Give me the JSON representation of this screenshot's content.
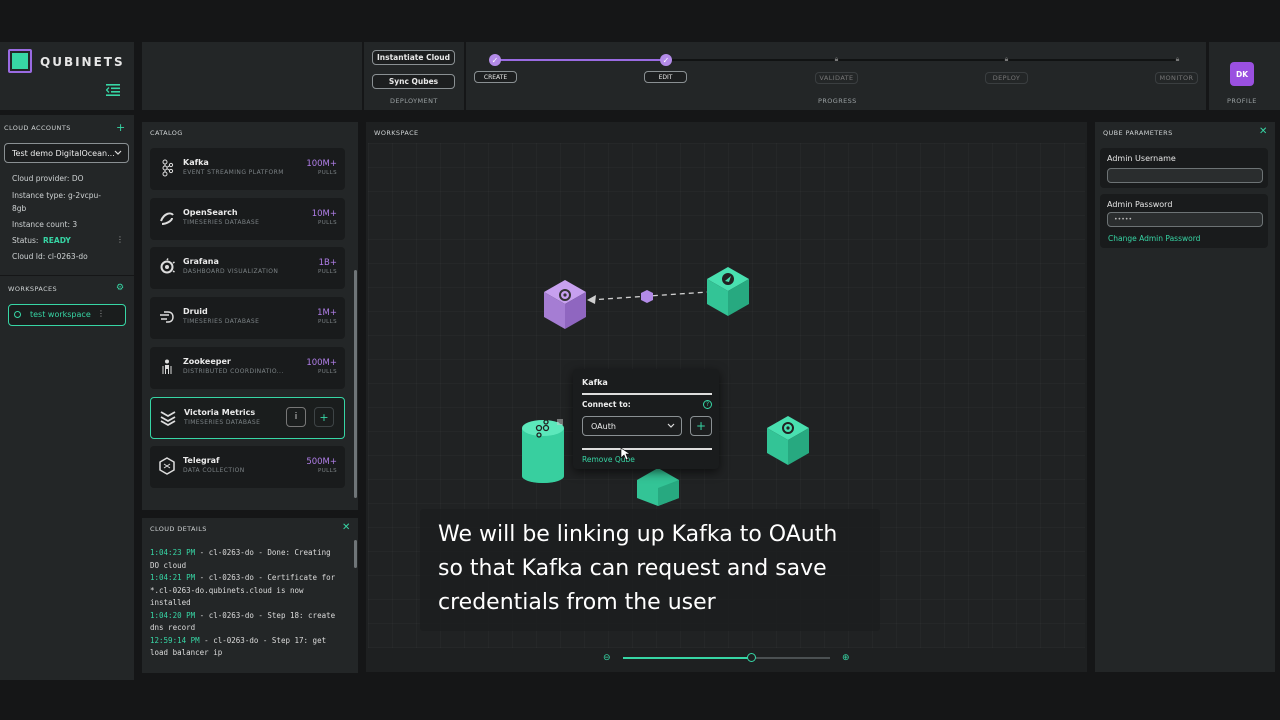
{
  "brand": {
    "name": "QUBINETS"
  },
  "deployment": {
    "instantiate_label": "Instantiate Cloud",
    "sync_label": "Sync Qubes",
    "section_label": "DEPLOYMENT"
  },
  "progress": {
    "section_label": "PROGRESS",
    "steps": [
      {
        "label": "CREATE",
        "state": "done"
      },
      {
        "label": "EDIT",
        "state": "done"
      },
      {
        "label": "VALIDATE",
        "state": "locked"
      },
      {
        "label": "DEPLOY",
        "state": "locked"
      },
      {
        "label": "MONITOR",
        "state": "locked"
      }
    ]
  },
  "profile": {
    "initials": "DK",
    "label": "PROFILE"
  },
  "cloud_accounts": {
    "title": "CLOUD ACCOUNTS",
    "selected": "Test demo DigitalOcean...",
    "provider_line": "Cloud provider: DO",
    "instance_type_line1": "Instance type: g-2vcpu-",
    "instance_type_line2": "8gb",
    "instance_count_line": "Instance count: 3",
    "status_label": "Status:",
    "status_value": "READY",
    "cloud_id_line": "Cloud Id: cl-0263-do"
  },
  "workspaces": {
    "title": "WORKSPACES",
    "items": [
      {
        "label": "test workspace"
      }
    ]
  },
  "catalog": {
    "title": "CATALOG",
    "items": [
      {
        "name": "Kafka",
        "sub": "EVENT STREAMING PLATFORM",
        "pulls": "100M+"
      },
      {
        "name": "OpenSearch",
        "sub": "TIMESERIES DATABASE",
        "pulls": "10M+"
      },
      {
        "name": "Grafana",
        "sub": "DASHBOARD VISUALIZATION",
        "pulls": "1B+"
      },
      {
        "name": "Druid",
        "sub": "TIMESERIES DATABASE",
        "pulls": "1M+"
      },
      {
        "name": "Zookeeper",
        "sub": "DISTRIBUTED COORDINATIO...",
        "pulls": "100M+"
      },
      {
        "name": "Victoria Metrics",
        "sub": "TIMESERIES DATABASE",
        "pulls": ""
      },
      {
        "name": "Telegraf",
        "sub": "DATA COLLECTION",
        "pulls": "500M+"
      }
    ],
    "pulls_label": "PULLS",
    "info_btn": "i",
    "add_btn": "+"
  },
  "cloud_details": {
    "title": "CLOUD DETAILS",
    "logs": [
      {
        "time": "1:04:23 PM",
        "rest": " - cl-0263-do - Done: Creating",
        "cont": "DO cloud"
      },
      {
        "time": "1:04:21 PM",
        "rest": " - cl-0263-do - Certificate for",
        "cont": "*.cl-0263-do.qubinets.cloud is now",
        "cont2": "installed"
      },
      {
        "time": "1:04:20 PM",
        "rest": " - cl-0263-do - Step 18: create",
        "cont": "dns record"
      },
      {
        "time": "12:59:14 PM",
        "rest": " - cl-0263-do - Step 17: get",
        "cont": "load balancer ip"
      }
    ]
  },
  "workspace": {
    "title": "WORKSPACE",
    "zoom_level": 0.62
  },
  "popup": {
    "title": "Kafka",
    "connect_label": "Connect to:",
    "selected": "OAuth",
    "add": "+",
    "remove": "Remove Qube"
  },
  "qube_params": {
    "title": "QUBE PARAMETERS",
    "username_label": "Admin Username",
    "username_value": "",
    "password_label": "Admin Password",
    "password_value": "•••••",
    "change_password": "Change Admin Password"
  },
  "caption": {
    "line1": "We will be linking up Kafka to OAuth",
    "line2": "so that Kafka can request and save",
    "line3": "credentials from the user"
  },
  "colors": {
    "accent_green": "#37d6a5",
    "accent_purple": "#b07ee8",
    "panel": "#232627"
  }
}
